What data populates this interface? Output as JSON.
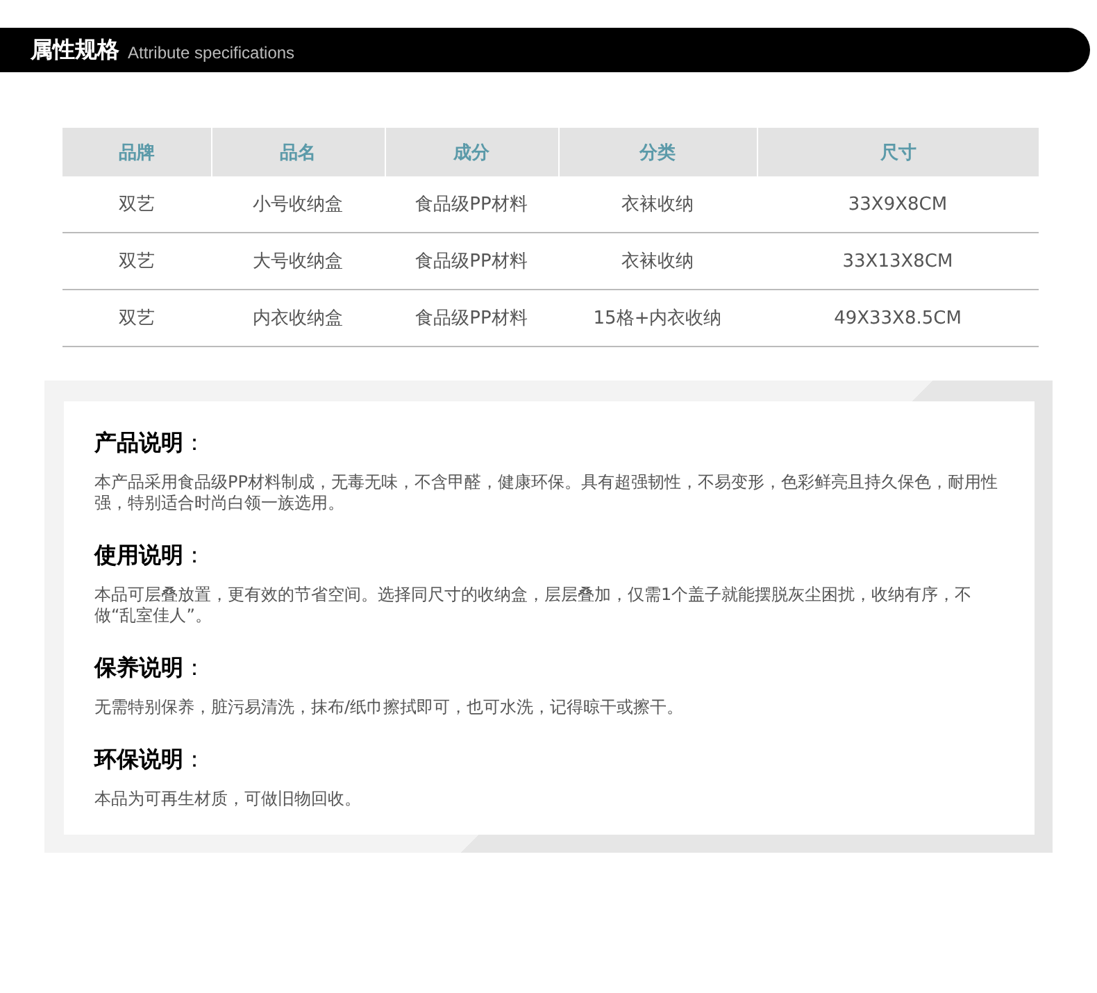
{
  "header": {
    "title": "属性规格",
    "subtitle": "Attribute specifications"
  },
  "table": {
    "columns": [
      "品牌",
      "品名",
      "成分",
      "分类",
      "尺寸"
    ],
    "rows": [
      [
        "双艺",
        "小号收纳盒",
        "食品级PP材料",
        "衣袜收纳",
        "33X9X8CM"
      ],
      [
        "双艺",
        "大号收纳盒",
        "食品级PP材料",
        "衣袜收纳",
        "33X13X8CM"
      ],
      [
        "双艺",
        "内衣收纳盒",
        "食品级PP材料",
        "15格+内衣收纳",
        "49X33X8.5CM"
      ]
    ]
  },
  "sections": [
    {
      "heading": "**产品说明**：",
      "text": "本产品采用食品级PP材料制成，无毒无味，不含甲醛，健康环保。具有超强韧性，不易变形，色彩鲜亮且持久保色，耐用性强，特别适合时尚白领一族选用。"
    },
    {
      "heading": "**使用说明**：",
      "text": "本品可层叠放置，更有效的节省空间。选择同尺寸的收纳盒，层层叠加，仅需1个盖子就能摆脱灰尘困扰，收纳有序，不做“乱室佳人”。"
    },
    {
      "heading": "**保养说明**：",
      "text": "无需特别保养，脏污易清洗，抹布/纸巾擦拭即可，也可水洗，记得晾干或擦干。"
    },
    {
      "heading": "**环保说明**：",
      "text": "本品为可再生材质，可做旧物回收。"
    }
  ]
}
